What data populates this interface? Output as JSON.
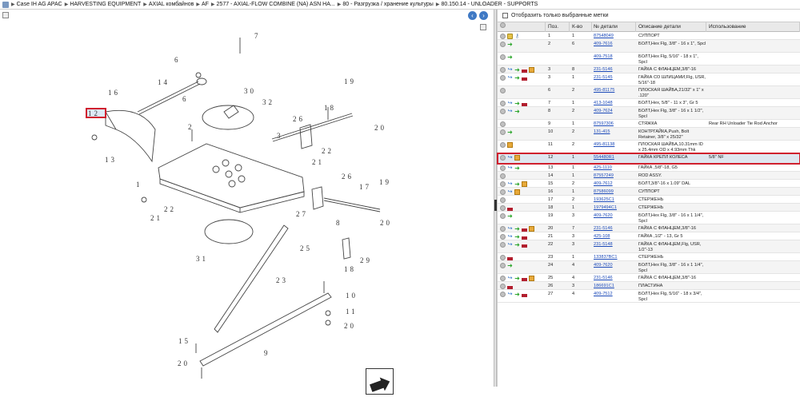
{
  "breadcrumb": [
    "Case IH AG APAC",
    "HARVESTING EQUIPMENT",
    "AXIAL комбайнов",
    "AF",
    "2577 - AXIAL-FLOW COMBINE (NA) ASN HA...",
    "80 - Разгрузка / хранение культуры",
    "80.150.14 - UNLOADER - SUPPORTS"
  ],
  "filter_label": "Отобразить только выбранные метки",
  "columns": [
    "Поз.",
    "К-во",
    "№ детали",
    "Описание детали",
    "Использование"
  ],
  "callouts": [
    "7",
    "6",
    "14",
    "6",
    "16",
    "12",
    "13",
    "30",
    "32",
    "2",
    "3",
    "19",
    "18",
    "26",
    "20",
    "20",
    "22",
    "21",
    "1",
    "26",
    "17",
    "19",
    "22",
    "21",
    "27",
    "8",
    "25",
    "31",
    "29",
    "23",
    "18",
    "10",
    "11",
    "20",
    "15",
    "20",
    "9",
    "18"
  ],
  "rows": [
    {
      "icons": [
        "zoom",
        "lock",
        "key"
      ],
      "pos": "1",
      "qty": "1",
      "part": "87548049",
      "desc": "СУППОРТ",
      "use": ""
    },
    {
      "icons": [
        "zoom",
        "arrow"
      ],
      "pos": "2",
      "qty": "6",
      "part": "409-7616",
      "desc": "БОЛТ,Hex Flg, 3/8\" - 16 x 1\", Spcl",
      "use": ""
    },
    {
      "icons": [
        "zoom",
        "arrow"
      ],
      "pos": "",
      "qty": "",
      "part": "409-7518",
      "desc": "БОЛТ,Hex Flg, 5/16\" - 18 x 1\", Spcl",
      "use": ""
    },
    {
      "icons": [
        "zoom",
        "share",
        "arrow",
        "doc",
        "box"
      ],
      "pos": "3",
      "qty": "8",
      "part": "231-5146",
      "desc": "ГАЙКА С ФЛАНЦЕМ,3/8\"-16",
      "use": ""
    },
    {
      "icons": [
        "zoom",
        "share",
        "arrow",
        "doc"
      ],
      "pos": "3",
      "qty": "1",
      "part": "231-5145",
      "desc": "ГАЙКА СО ШЛИЦАМИ,Flg, USR, 5/16\"-18",
      "use": ""
    },
    {
      "icons": [
        "zoom"
      ],
      "pos": "6",
      "qty": "2",
      "part": "495-81175",
      "desc": "ПЛОСКАЯ ШАЙБА,21/32\" x 1\" x .120\"",
      "use": ""
    },
    {
      "icons": [
        "zoom",
        "share",
        "arrow",
        "doc"
      ],
      "pos": "7",
      "qty": "1",
      "part": "413-1048",
      "desc": "БОЛТ,Hex, 5/8\" - 11 x 3\", Gr 5",
      "use": ""
    },
    {
      "icons": [
        "zoom",
        "share",
        "arrow"
      ],
      "pos": "8",
      "qty": "2",
      "part": "409-7624",
      "desc": "БОЛТ,Hex Flg, 3/8\" - 16 x 1 1/2\", Spcl",
      "use": ""
    },
    {
      "icons": [
        "zoom"
      ],
      "pos": "9",
      "qty": "1",
      "part": "87597306",
      "desc": "СТЯЖКА",
      "use": "Rear RH Unloader Tie Rod Anchor"
    },
    {
      "icons": [
        "zoom",
        "arrow"
      ],
      "pos": "10",
      "qty": "2",
      "part": "131-415",
      "desc": "КОНТРГАЙКА,Push, Bolt Retainer, 3/8\" x 25/32\"",
      "use": ""
    },
    {
      "icons": [
        "zoom",
        "box"
      ],
      "pos": "11",
      "qty": "2",
      "part": "495-81138",
      "desc": "ПЛОСКАЯ ШАЙБА,10.31mm ID x 25.4mm OD x 4.93mm Thk",
      "use": ""
    },
    {
      "icons": [
        "zoom",
        "share",
        "box"
      ],
      "pos": "12",
      "qty": "1",
      "part": "554480R1",
      "desc": "ГАЙКА КРЕПЛ КОЛЕСА",
      "use": "5/8\" NF",
      "selected": true
    },
    {
      "icons": [
        "zoom",
        "share",
        "arrow"
      ],
      "pos": "13",
      "qty": "1",
      "part": "425-1110",
      "desc": "ГАЙКА ,5/8\"-18, G5",
      "use": ""
    },
    {
      "icons": [
        "zoom"
      ],
      "pos": "14",
      "qty": "1",
      "part": "87557249",
      "desc": "ROD ASSY.",
      "use": ""
    },
    {
      "icons": [
        "zoom",
        "share",
        "arrow",
        "box"
      ],
      "pos": "15",
      "qty": "2",
      "part": "409-7612",
      "desc": "БОЛТ,3/8\"-16 x 1.09\" DAL",
      "use": ""
    },
    {
      "icons": [
        "zoom",
        "share",
        "box"
      ],
      "pos": "16",
      "qty": "1",
      "part": "87586099",
      "desc": "СУППОРТ",
      "use": ""
    },
    {
      "icons": [
        "zoom"
      ],
      "pos": "17",
      "qty": "2",
      "part": "193625C1",
      "desc": "СТЕРЖЕНЬ",
      "use": ""
    },
    {
      "icons": [
        "zoom",
        "doc"
      ],
      "pos": "18",
      "qty": "1",
      "part": "1979494C1",
      "desc": "СТЕРЖЕНЬ",
      "use": ""
    },
    {
      "icons": [
        "zoom",
        "arrow"
      ],
      "pos": "19",
      "qty": "3",
      "part": "409-7620",
      "desc": "БОЛТ,Hex Flg, 3/8\" - 16 x 1 1/4\", Spcl",
      "use": ""
    },
    {
      "icons": [
        "zoom",
        "share",
        "arrow",
        "doc",
        "box"
      ],
      "pos": "20",
      "qty": "7",
      "part": "231-5146",
      "desc": "ГАЙКА С ФЛАНЦЕМ,3/8\"-16",
      "use": ""
    },
    {
      "icons": [
        "zoom",
        "share",
        "arrow",
        "doc"
      ],
      "pos": "21",
      "qty": "3",
      "part": "425-108",
      "desc": "ГАЙКА ,1/2\" - 13, Gr 5",
      "use": ""
    },
    {
      "icons": [
        "zoom",
        "share",
        "arrow",
        "doc"
      ],
      "pos": "22",
      "qty": "3",
      "part": "231-5148",
      "desc": "ГАЙКА С ФЛАНЦЕМ,Flg, USR, 1/2\"-13",
      "use": ""
    },
    {
      "icons": [
        "zoom",
        "doc"
      ],
      "pos": "23",
      "qty": "1",
      "part": "133837BC1",
      "desc": "СТЕРЖЕНЬ",
      "use": ""
    },
    {
      "icons": [
        "zoom",
        "arrow"
      ],
      "pos": "24",
      "qty": "4",
      "part": "409-7620",
      "desc": "БОЛТ,Hex Flg, 3/8\" - 16 x 1 1/4\", Spcl",
      "use": ""
    },
    {
      "icons": [
        "zoom",
        "share",
        "arrow",
        "doc",
        "box"
      ],
      "pos": "25",
      "qty": "4",
      "part": "231-5146",
      "desc": "ГАЙКА С ФЛАНЦЕМ,3/8\"-16",
      "use": ""
    },
    {
      "icons": [
        "zoom",
        "doc"
      ],
      "pos": "26",
      "qty": "3",
      "part": "186691C1",
      "desc": "ПЛАСТИНА",
      "use": ""
    },
    {
      "icons": [
        "zoom",
        "share",
        "arrow",
        "doc"
      ],
      "pos": "27",
      "qty": "4",
      "part": "409-7512",
      "desc": "БОЛТ,Hex Flg, 5/16\" - 18 x 3/4\", Spcl",
      "use": ""
    }
  ]
}
